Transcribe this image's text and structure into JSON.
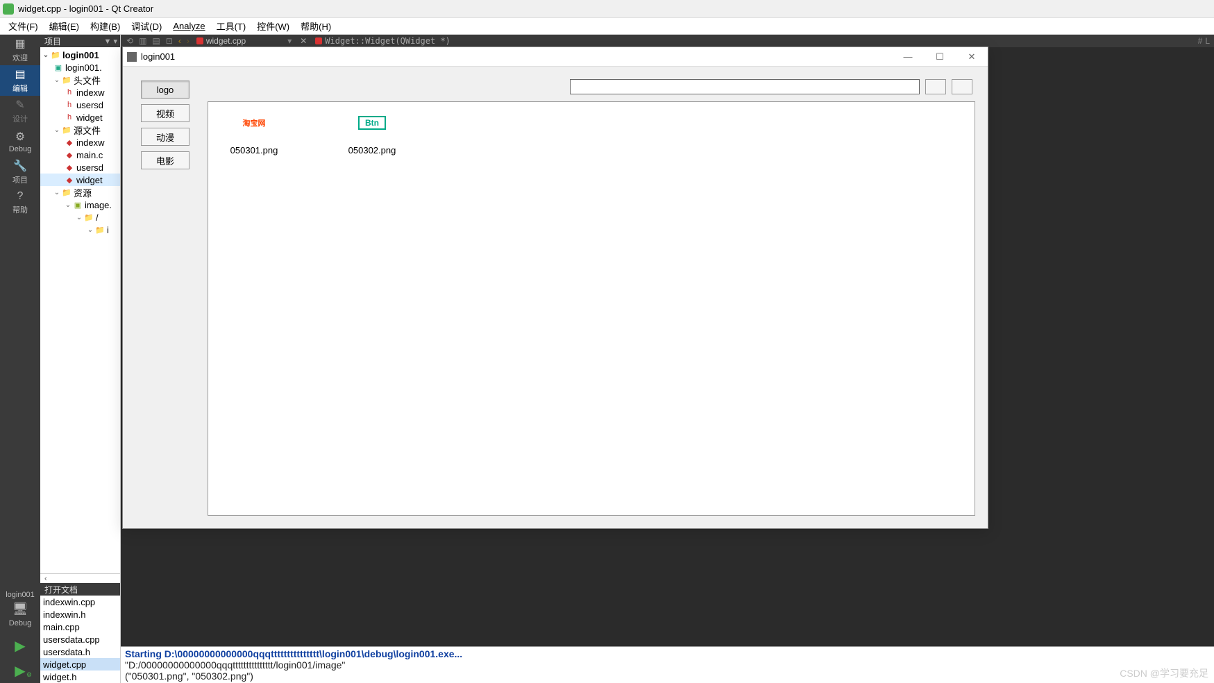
{
  "window": {
    "title": "widget.cpp - login001 - Qt Creator"
  },
  "menu": {
    "file": "文件(F)",
    "edit": "编辑(E)",
    "build": "构建(B)",
    "debug": "调试(D)",
    "analyze": "Analyze",
    "tools": "工具(T)",
    "widgets": "控件(W)",
    "help": "帮助(H)"
  },
  "mode": {
    "welcome": "欢迎",
    "edit": "编辑",
    "design": "设计",
    "debug": "Debug",
    "projects": "项目",
    "help": "帮助"
  },
  "kit": {
    "name": "login001",
    "config": "Debug"
  },
  "panel": {
    "title": "项目",
    "open_docs_title": "打开文档"
  },
  "tree": {
    "root": "login001",
    "pro": "login001.",
    "headers": "头文件",
    "h1": "indexw",
    "h2": "usersd",
    "h3": "widget",
    "sources": "源文件",
    "s1": "indexw",
    "s2": "main.c",
    "s3": "usersd",
    "s4": "widget",
    "resources": "资源",
    "r1": "image.",
    "r2": "/",
    "r3": "i"
  },
  "open_docs": {
    "d0": "indexwin.cpp",
    "d1": "indexwin.h",
    "d2": "main.cpp",
    "d3": "usersdata.cpp",
    "d4": "usersdata.h",
    "d5": "widget.cpp",
    "d6": "widget.h"
  },
  "tabs": {
    "current": "widget.cpp",
    "breadcrumb": "Widget::Widget(QWidget *)",
    "hash": "#",
    "L": "L"
  },
  "console": {
    "l1": "Starting D:\\00000000000000qqqttttttttttttttt\\login001\\debug\\login001.exe...",
    "l2": "\"D:/00000000000000qqqttttttttttttttt/login001/image\"",
    "l3": "(\"050301.png\", \"050302.png\")"
  },
  "app": {
    "title": "login001",
    "buttons": {
      "logo": "logo",
      "video": "视频",
      "anime": "动漫",
      "movie": "电影"
    },
    "items": {
      "i1_thumb": "淘宝网",
      "i1_name": "050301.png",
      "i2_thumb": "Btn",
      "i2_name": "050302.png"
    }
  },
  "watermark": "CSDN @学习要充足"
}
